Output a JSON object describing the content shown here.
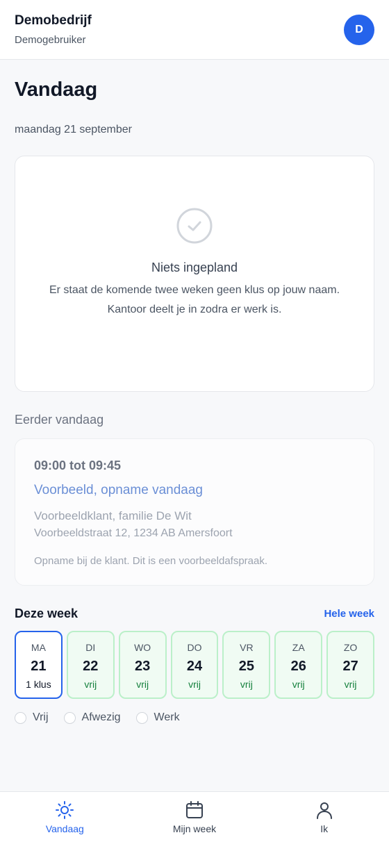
{
  "header": {
    "company": "Demobedrijf",
    "user": "Demogebruiker",
    "avatar_initial": "D"
  },
  "page": {
    "title": "Vandaag",
    "date": "maandag 21 september"
  },
  "empty_state": {
    "title": "Niets ingepland",
    "message": "Er staat de komende twee weken geen klus op jouw naam. Kantoor deelt je in zodra er werk is."
  },
  "earlier": {
    "section_title": "Eerder vandaag",
    "time": "09:00 tot 09:45",
    "title": "Voorbeeld, opname vandaag",
    "client": "Voorbeeldklant, familie De Wit",
    "address": "Voorbeeldstraat 12, 1234 AB Amersfoort",
    "note": "Opname bij de klant. Dit is een voorbeeldafspraak."
  },
  "week": {
    "title": "Deze week",
    "link": "Hele week",
    "days": [
      {
        "name": "MA",
        "date": "21",
        "status": "1 klus"
      },
      {
        "name": "DI",
        "date": "22",
        "status": "vrij"
      },
      {
        "name": "WO",
        "date": "23",
        "status": "vrij"
      },
      {
        "name": "DO",
        "date": "24",
        "status": "vrij"
      },
      {
        "name": "VR",
        "date": "25",
        "status": "vrij"
      },
      {
        "name": "ZA",
        "date": "26",
        "status": "vrij"
      },
      {
        "name": "ZO",
        "date": "27",
        "status": "vrij"
      }
    ],
    "legend": [
      "Vrij",
      "Afwezig",
      "Werk"
    ]
  },
  "nav": {
    "items": [
      "Vandaag",
      "Mijn week",
      "Ik"
    ],
    "active": "Vandaag"
  },
  "colors": {
    "accent": "#2563eb",
    "free_bg": "#f0fbf3",
    "free_border": "#bbf0c9",
    "free_text": "#15803d"
  }
}
